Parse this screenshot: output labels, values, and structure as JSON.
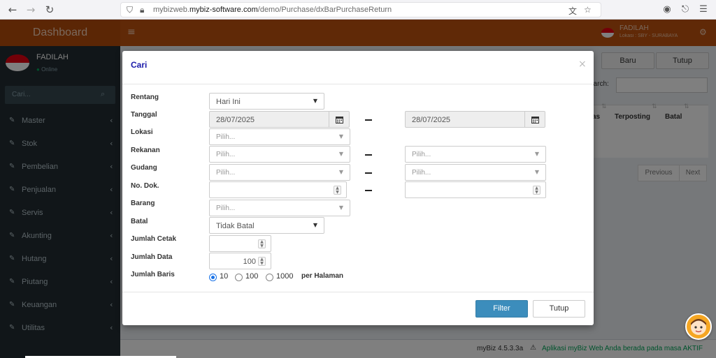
{
  "browser": {
    "url_prefix": "mybizweb.",
    "url_domain": "mybiz-software.com",
    "url_path": "/demo/Purchase/dxBarPurchaseReturn"
  },
  "header": {
    "brand": "Dashboard",
    "user_name": "FADILAH",
    "user_location": "Lokasi : SBY - SURABAYA"
  },
  "sidebar": {
    "user_name": "FADILAH",
    "status": "Online",
    "search_placeholder": "Cari...",
    "items": [
      {
        "label": "Master"
      },
      {
        "label": "Stok"
      },
      {
        "label": "Pembelian"
      },
      {
        "label": "Penjualan"
      },
      {
        "label": "Servis"
      },
      {
        "label": "Akunting"
      },
      {
        "label": "Hutang"
      },
      {
        "label": "Piutang"
      },
      {
        "label": "Keuangan"
      },
      {
        "label": "Utilitas"
      }
    ]
  },
  "background": {
    "baru_label": "Baru",
    "tutup_label": "Tutup",
    "search_label": "earch:",
    "col_partial": "as",
    "col_terposting": "Terposting",
    "col_batal": "Batal",
    "previous_label": "Previous",
    "next_label": "Next"
  },
  "footer": {
    "version": "myBiz 4.5.3.3a",
    "message": "Aplikasi myBiz Web Anda berada pada masa AKTIF"
  },
  "modal": {
    "title": "Cari",
    "close": "×",
    "labels": {
      "rentang": "Rentang",
      "tanggal": "Tanggal",
      "lokasi": "Lokasi",
      "rekanan": "Rekanan",
      "gudang": "Gudang",
      "no_dok": "No. Dok.",
      "barang": "Barang",
      "batal": "Batal",
      "jumlah_cetak": "Jumlah Cetak",
      "jumlah_data": "Jumlah Data",
      "jumlah_baris": "Jumlah Baris"
    },
    "rentang_value": "Hari Ini",
    "tanggal_from": "28/07/2025",
    "tanggal_to": "28/07/2025",
    "pilih_placeholder": "Pilih...",
    "batal_value": "Tidak Batal",
    "jumlah_data_value": "100",
    "baris_options": [
      "10",
      "100",
      "1000"
    ],
    "baris_selected": "10",
    "per_halaman": "per Halaman",
    "filter_label": "Filter",
    "tutup_label": "Tutup"
  }
}
